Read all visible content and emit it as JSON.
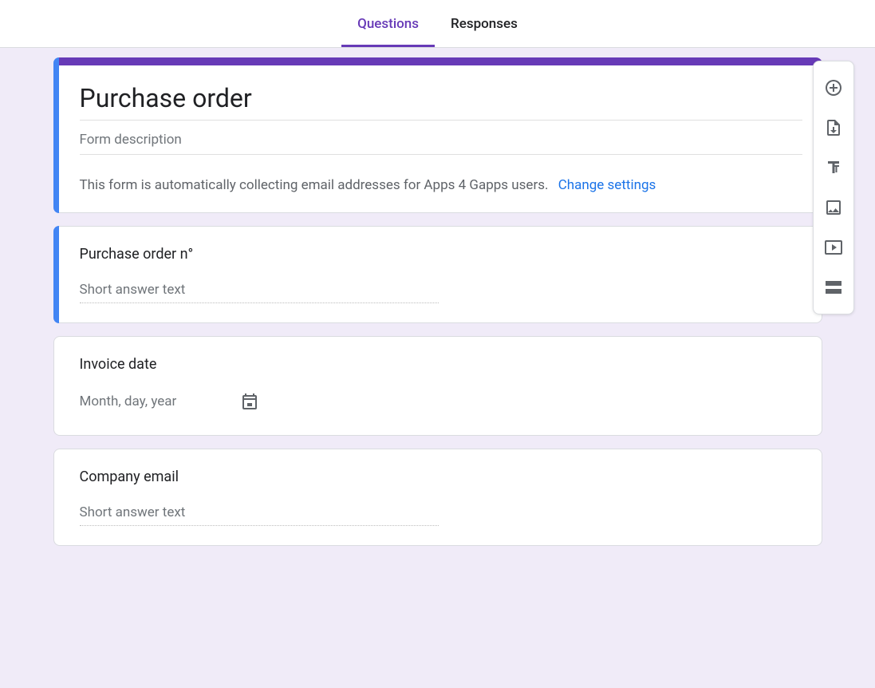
{
  "tabs": {
    "questions": "Questions",
    "responses": "Responses"
  },
  "header": {
    "title": "Purchase order",
    "description_placeholder": "Form description",
    "email_notice": "This form is automatically collecting email addresses for Apps 4 Gapps users.",
    "change_settings": "Change settings"
  },
  "questions": [
    {
      "title": "Purchase order n°",
      "type": "short_answer",
      "placeholder": "Short answer text"
    },
    {
      "title": "Invoice date",
      "type": "date",
      "placeholder": "Month, day, year"
    },
    {
      "title": "Company email",
      "type": "short_answer",
      "placeholder": "Short answer text"
    }
  ],
  "toolbar": {
    "add_question": "Add question",
    "import_questions": "Import questions",
    "add_title": "Add title and description",
    "add_image": "Add image",
    "add_video": "Add video",
    "add_section": "Add section"
  }
}
